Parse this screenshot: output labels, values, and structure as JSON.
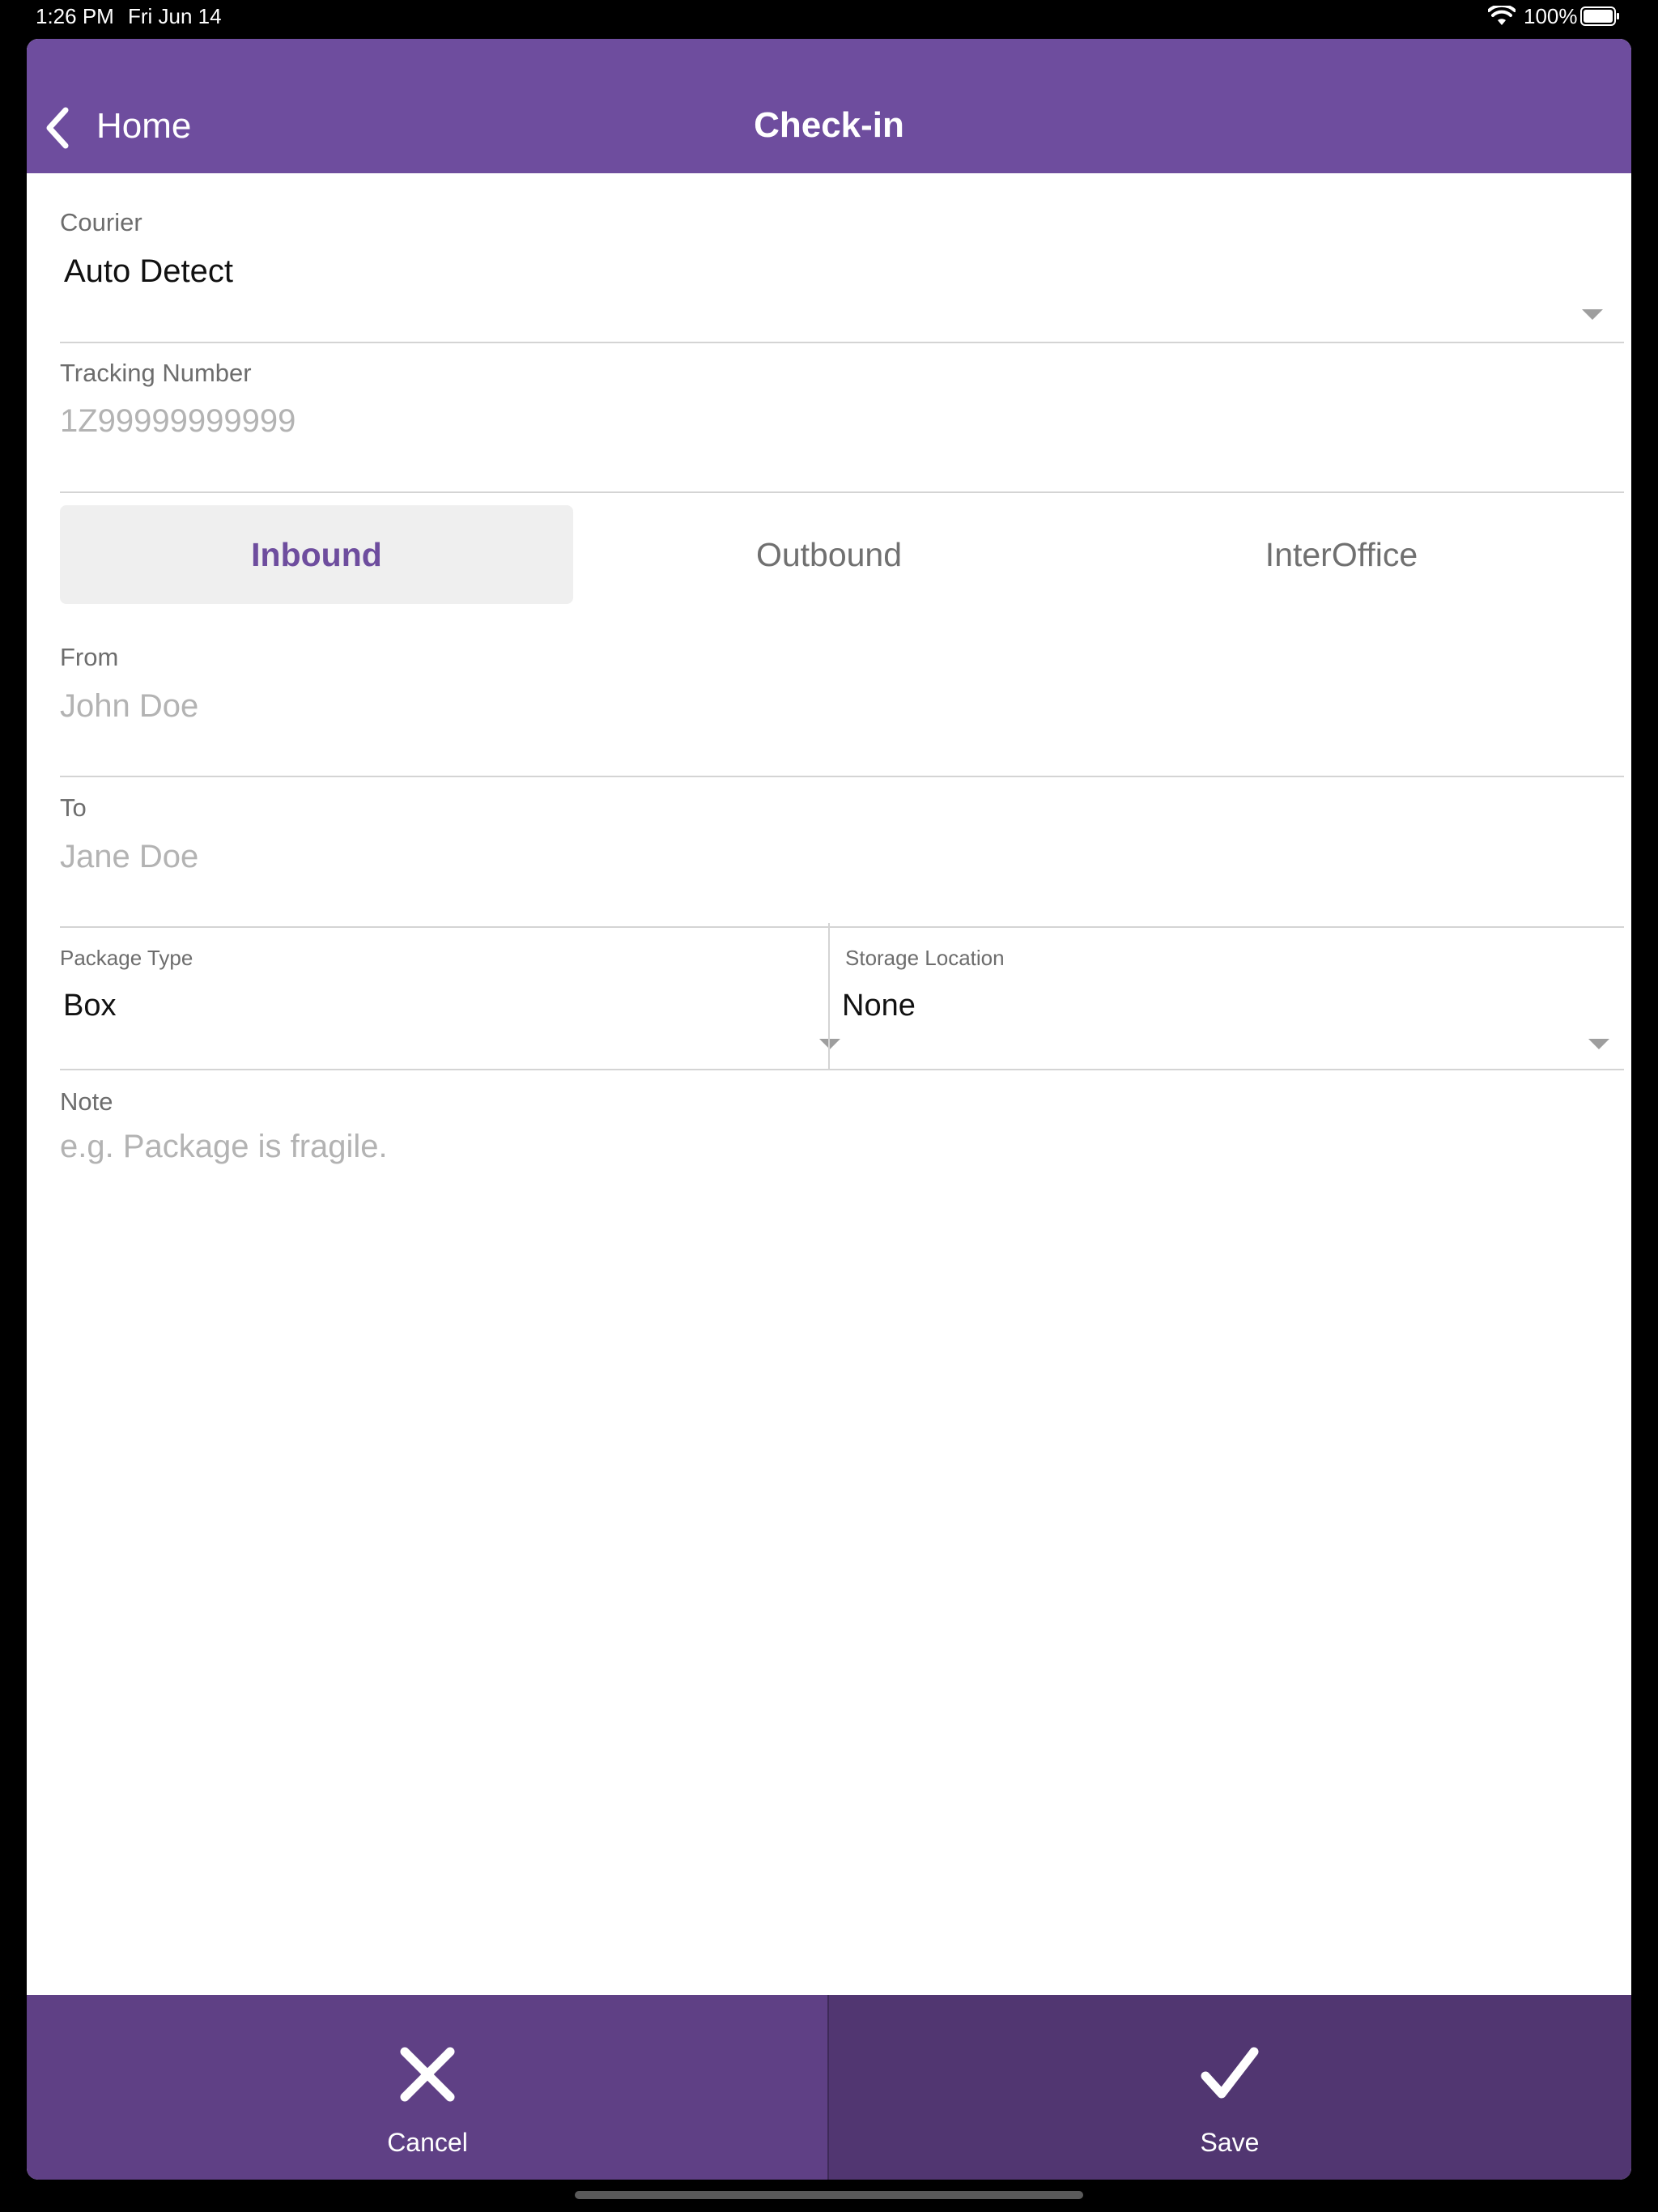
{
  "status_bar": {
    "time": "1:26 PM",
    "date": "Fri Jun 14",
    "battery_percent": "100%",
    "icons": [
      "wifi-icon",
      "battery-icon"
    ]
  },
  "nav": {
    "back_label": "Home",
    "title": "Check-in",
    "back_icon": "chevron-left-icon",
    "bar_color": "#6e4d9e"
  },
  "form": {
    "courier": {
      "label": "Courier",
      "value": "Auto Detect"
    },
    "tracking": {
      "label": "Tracking Number",
      "placeholder": "1Z99999999999"
    },
    "direction": {
      "options": [
        "Inbound",
        "Outbound",
        "InterOffice"
      ],
      "selected": "Inbound"
    },
    "from": {
      "label": "From",
      "placeholder": "John Doe"
    },
    "to": {
      "label": "To",
      "placeholder": "Jane Doe"
    },
    "package_type": {
      "label": "Package Type",
      "value": "Box"
    },
    "storage_location": {
      "label": "Storage Location",
      "value": "None"
    },
    "note": {
      "label": "Note",
      "placeholder": "e.g. Package is fragile."
    }
  },
  "actions": {
    "cancel_label": "Cancel",
    "save_label": "Save",
    "cancel_icon": "close-icon",
    "save_icon": "checkmark-icon"
  }
}
